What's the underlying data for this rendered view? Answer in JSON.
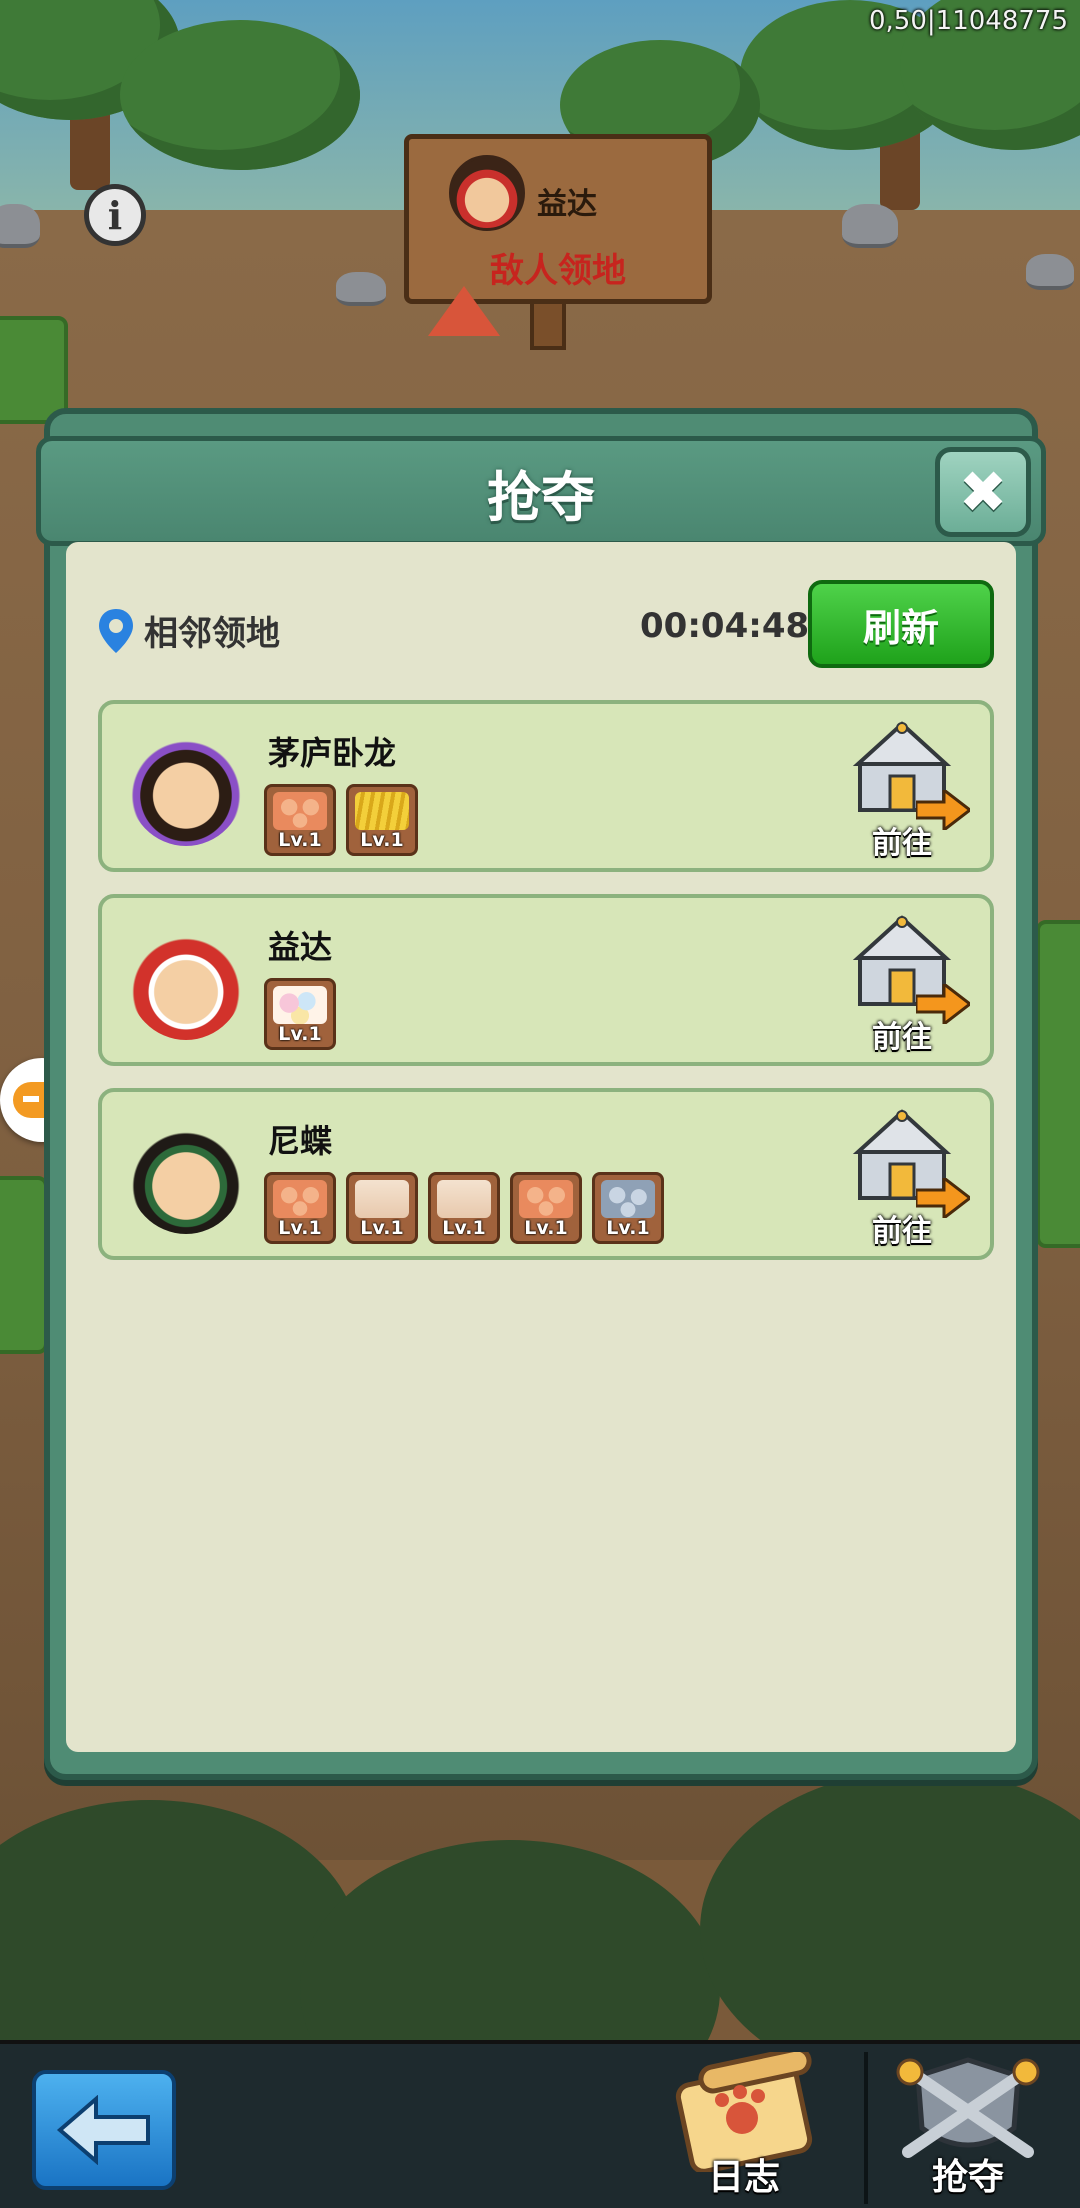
{
  "hud": {
    "server_info": "0,50|11048775"
  },
  "sign": {
    "owner_name": "益达",
    "title": "敌人领地"
  },
  "dialog": {
    "title": "抢夺",
    "location_label": "相邻领地",
    "countdown": "00:04:48",
    "refresh_label": "刷新"
  },
  "targets": [
    {
      "name": "茅庐卧龙",
      "resources": [
        {
          "icon": "meat",
          "level": "Lv.1"
        },
        {
          "icon": "grain",
          "level": "Lv.1"
        }
      ],
      "action": "前往"
    },
    {
      "name": "益达",
      "resources": [
        {
          "icon": "egg",
          "level": "Lv.1"
        }
      ],
      "action": "前往"
    },
    {
      "name": "尼蝶",
      "resources": [
        {
          "icon": "meat",
          "level": "Lv.1"
        },
        {
          "icon": "cloth",
          "level": "Lv.1"
        },
        {
          "icon": "cloth",
          "level": "Lv.1"
        },
        {
          "icon": "meat",
          "level": "Lv.1"
        },
        {
          "icon": "stone",
          "level": "Lv.1"
        }
      ],
      "action": "前往"
    }
  ],
  "bottom_bar": {
    "log_label": "日志",
    "rob_label": "抢夺"
  },
  "colors": {
    "accent_green": "#1fa21b",
    "dialog_teal": "#4f8c74",
    "title_red": "#c7241e"
  }
}
